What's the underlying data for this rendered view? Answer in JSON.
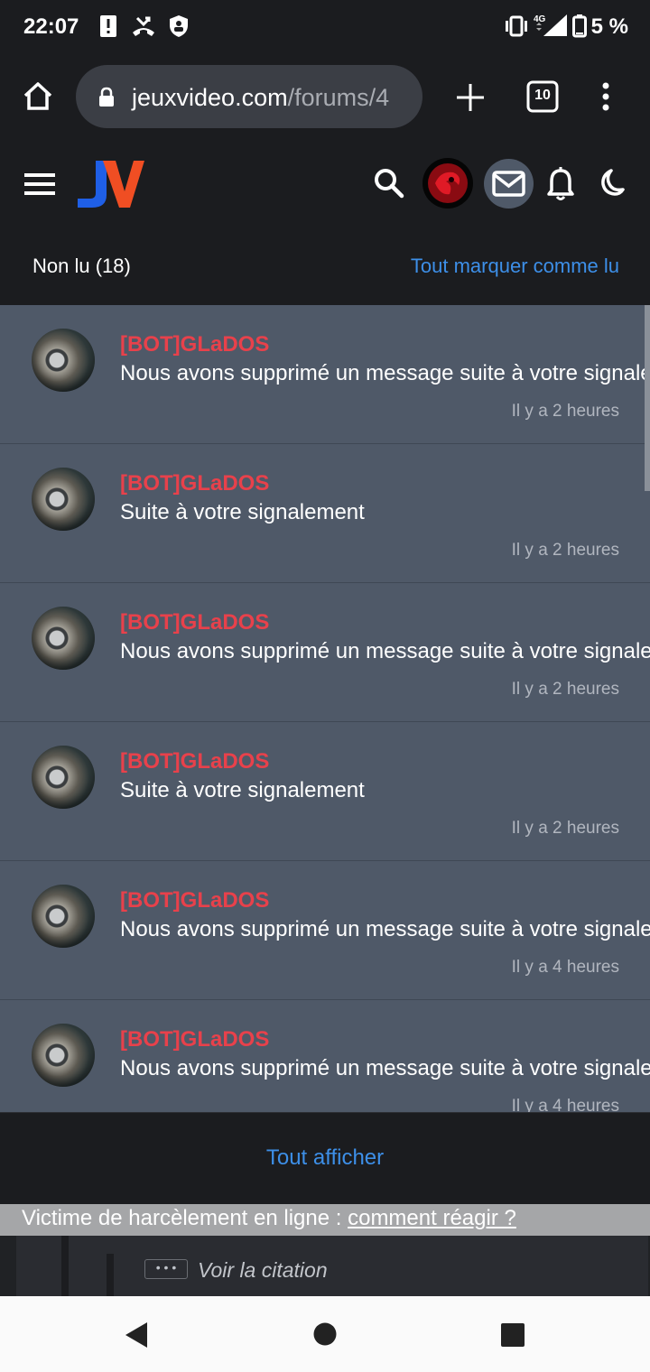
{
  "status_bar": {
    "time": "22:07",
    "network": "4G",
    "battery": "5 %",
    "icons": [
      "alert-icon",
      "missed-call-icon",
      "shield-icon",
      "vibrate-icon",
      "signal-icon",
      "battery-icon"
    ]
  },
  "browser": {
    "url_domain": "jeuxvideo.com",
    "url_path": "/forums/4",
    "tab_count": "10",
    "icons": [
      "home-icon",
      "lock-icon",
      "new-tab-icon",
      "tabs-icon",
      "menu-dots-icon"
    ]
  },
  "site_header": {
    "logo_text": "JV",
    "icons": [
      "hamburger-icon",
      "search-icon",
      "avatar",
      "mail-icon",
      "bell-icon",
      "moon-icon"
    ],
    "colors": {
      "logo_blue": "#1f5fe6",
      "logo_orange": "#f04e23"
    }
  },
  "notifications": {
    "unread_label": "Non lu (18)",
    "mark_all_label": "Tout marquer comme lu",
    "items": [
      {
        "author": "[BOT]GLaDOS",
        "message": "Nous avons supprimé un message suite à votre signalement",
        "time": "Il y a 2 heures"
      },
      {
        "author": "[BOT]GLaDOS",
        "message": "Suite à votre signalement",
        "time": "Il y a 2 heures"
      },
      {
        "author": "[BOT]GLaDOS",
        "message": "Nous avons supprimé un message suite à votre signalement",
        "time": "Il y a 2 heures"
      },
      {
        "author": "[BOT]GLaDOS",
        "message": "Suite à votre signalement",
        "time": "Il y a 2 heures"
      },
      {
        "author": "[BOT]GLaDOS",
        "message": "Nous avons supprimé un message suite à votre signalement",
        "time": "Il y a 4 heures"
      },
      {
        "author": "[BOT]GLaDOS",
        "message": "Nous avons supprimé un message suite à votre signalement",
        "time": "Il y a 4 heures"
      }
    ],
    "show_all_label": "Tout afficher"
  },
  "page_below": {
    "harassment_text": "Victime de harcèlement en ligne : ",
    "harassment_link": "comment réagir ?",
    "quote_dots": "• • •",
    "quote_label": "Voir la citation"
  },
  "nav": {
    "icons": [
      "back-icon",
      "home-circle-icon",
      "recents-icon"
    ]
  },
  "colors": {
    "accent_link": "#3d8fe8",
    "author_red": "#e8414b",
    "row_bg": "#4f5968",
    "header_bg": "#1b1c1f"
  }
}
